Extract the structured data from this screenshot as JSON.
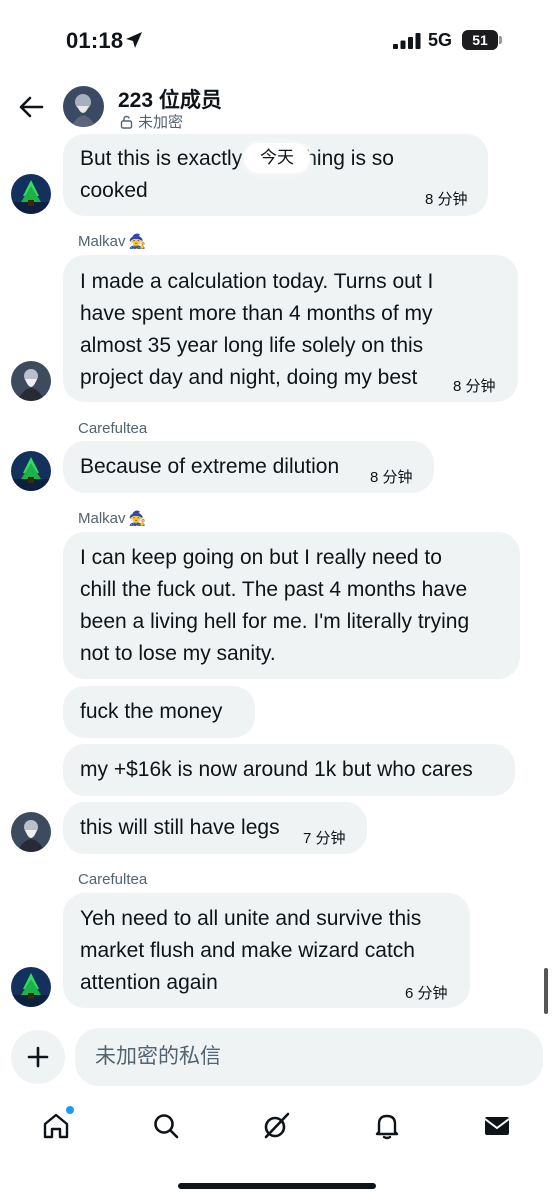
{
  "status_bar": {
    "time": "01:18",
    "network": "5G",
    "battery": "51"
  },
  "header": {
    "title": "223 位成员",
    "subtitle": "未加密"
  },
  "day_divider": "今天",
  "messages": [
    {
      "sender": "",
      "text": "But this is exactly everything is so\ncooked",
      "time": "8 分钟"
    },
    {
      "sender": "Malkav",
      "text": "I made a calculation today. Turns out I\nhave spent more than  4 months of my\nalmost 35 year long life solely on this\nproject day and night, doing my best",
      "time": "8 分钟"
    },
    {
      "sender": "Carefultea",
      "text": "Because of extreme dilution",
      "time": "8 分钟"
    },
    {
      "sender": "Malkav",
      "text": "I can keep going on but I really need to\nchill the fuck out. The past 4 months have\nbeen a living hell for me. I'm literally trying\nnot to lose my sanity.",
      "time": ""
    },
    {
      "sender": "",
      "text": "fuck the money",
      "time": ""
    },
    {
      "sender": "",
      "text": "my +$16k is now around 1k but who cares",
      "time": ""
    },
    {
      "sender": "",
      "text": "this will still have legs",
      "time": "7 分钟"
    },
    {
      "sender": "Carefultea",
      "text": "Yeh need to all unite and survive this\nmarket flush and make wizard catch\nattention again",
      "time": "6 分钟"
    }
  ],
  "composer": {
    "placeholder": "未加密的私信"
  },
  "nav": {
    "items": [
      "home-icon",
      "search-icon",
      "grok-icon",
      "notifications-icon",
      "messages-icon"
    ],
    "accent": "#1d9bf0"
  },
  "colors": {
    "bubble": "#eff3f4",
    "secondary_text": "#536471",
    "primary_text": "#0f1419"
  }
}
